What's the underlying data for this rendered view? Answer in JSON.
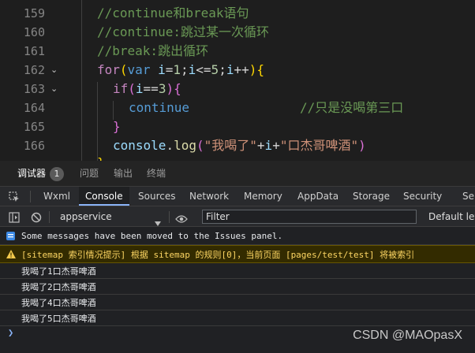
{
  "editor": {
    "line_numbers": [
      "159",
      "160",
      "161",
      "162",
      "163",
      "164",
      "165",
      "166"
    ],
    "comment1": "//continue和break语句",
    "comment2": "//continue:跳过某一次循环",
    "comment3": "//break:跳出循环",
    "for_kw": "for",
    "for_paren_open": "(",
    "var_kw": "var",
    "for_i1": " i",
    "for_eq": "=",
    "for_one": "1",
    "for_semi1": ";",
    "for_i2": "i",
    "for_le": "<=",
    "for_five": "5",
    "for_semi2": ";",
    "for_i3": "i",
    "for_pp": "++",
    "for_paren_close": ")",
    "for_brace": "{",
    "if_kw": "if",
    "if_paren_open": "(",
    "if_i": "i",
    "if_eq": "==",
    "if_three": "3",
    "if_paren_close": ")",
    "if_brace": "{",
    "continue_kw": "continue",
    "inline_comment": "//只是没喝第三口",
    "close_brace": "}",
    "console_obj": "console",
    "dot": ".",
    "log_fn": "log",
    "log_paren_open": "(",
    "str1": "\"我喝了\"",
    "plus1": "+",
    "log_i": "i",
    "plus2": "+",
    "str2": "\"口杰哥啤酒\"",
    "log_paren_close": ")"
  },
  "panel_tabs": {
    "debugger": "调试器",
    "badge": "1",
    "issues": "问题",
    "output": "输出",
    "terminal": "终端"
  },
  "devtools_tabs": [
    "Wxml",
    "Console",
    "Sources",
    "Network",
    "Memory",
    "AppData",
    "Storage",
    "Security",
    "Sen"
  ],
  "toolbar": {
    "context": "appservice",
    "filter_placeholder": "Filter",
    "levels": "Default levels"
  },
  "messages": [
    {
      "type": "info",
      "text": "Some messages have been moved to the Issues panel."
    },
    {
      "type": "warn",
      "text": "[sitemap 索引情况提示] 根据 sitemap 的规则[0]，当前页面 [pages/test/test] 将被索引"
    },
    {
      "type": "log",
      "text": "我喝了1口杰哥啤酒"
    },
    {
      "type": "log",
      "text": "我喝了2口杰哥啤酒"
    },
    {
      "type": "log",
      "text": "我喝了4口杰哥啤酒"
    },
    {
      "type": "log",
      "text": "我喝了5口杰哥啤酒"
    }
  ],
  "watermark": "CSDN @MAOpasX",
  "colors": {
    "editor_bg": "#1e1e1e",
    "comment": "#6a9955",
    "keyword": "#569cd6",
    "control": "#c586c0",
    "string": "#ce9178",
    "active_tab_underline": "#8ab4f8",
    "warning_bg": "#332b00"
  },
  "icons": [
    "chevron-down-icon",
    "inspect-icon",
    "device-toggle-icon",
    "sidebar-toggle-icon",
    "clear-console-icon",
    "dropdown-arrow-icon",
    "eye-icon",
    "info-icon",
    "warning-icon",
    "prompt-chevron-icon"
  ]
}
